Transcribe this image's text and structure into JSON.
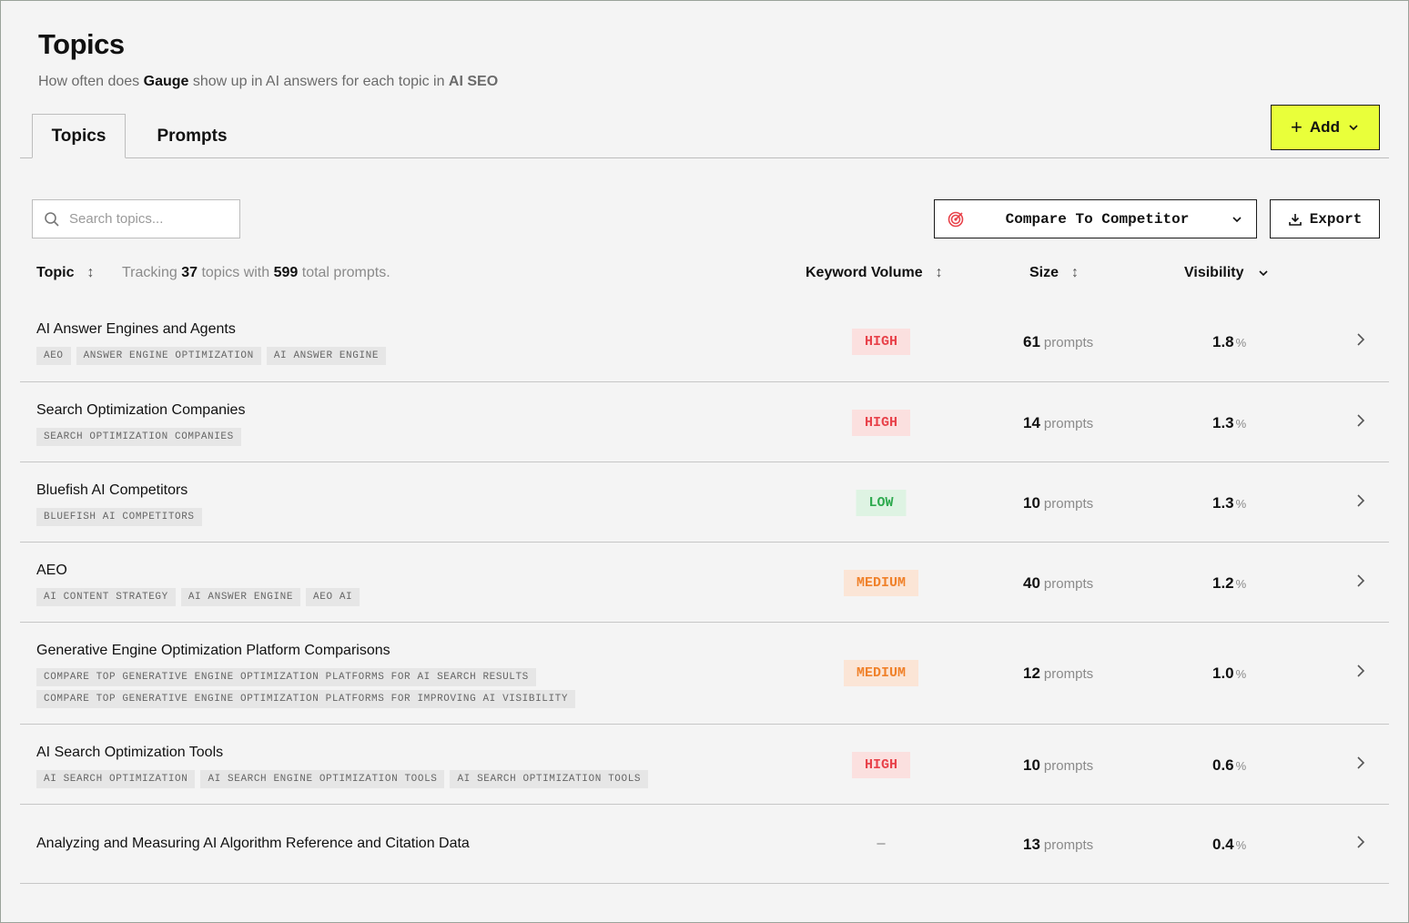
{
  "header": {
    "title": "Topics",
    "subtitle_prefix": "How often does ",
    "brand": "Gauge",
    "subtitle_mid": " show up in AI answers for each topic in ",
    "project": "AI SEO"
  },
  "tabs": [
    {
      "label": "Topics",
      "active": true
    },
    {
      "label": "Prompts",
      "active": false
    }
  ],
  "add_button": {
    "label": "Add"
  },
  "search": {
    "placeholder": "Search topics..."
  },
  "compare_button": {
    "label": "Compare To Competitor"
  },
  "export_button": {
    "label": "Export"
  },
  "table": {
    "col_topic": "Topic",
    "tracking_prefix": "Tracking ",
    "tracking_topics": "37",
    "tracking_mid": " topics with ",
    "tracking_prompts": "599",
    "tracking_suffix": " total prompts.",
    "col_keyword": "Keyword Volume",
    "col_size": "Size",
    "col_visibility": "Visibility",
    "rows": [
      {
        "title": "AI Answer Engines and Agents",
        "tags": [
          [
            "AEO",
            "ANSWER ENGINE OPTIMIZATION",
            "AI ANSWER ENGINE"
          ]
        ],
        "volume": "HIGH",
        "volume_level": "high",
        "size": "61",
        "size_unit": "prompts",
        "visibility": "1.8",
        "vis_unit": "%"
      },
      {
        "title": "Search Optimization Companies",
        "tags": [
          [
            "SEARCH OPTIMIZATION COMPANIES"
          ]
        ],
        "volume": "HIGH",
        "volume_level": "high",
        "size": "14",
        "size_unit": "prompts",
        "visibility": "1.3",
        "vis_unit": "%"
      },
      {
        "title": "Bluefish AI Competitors",
        "tags": [
          [
            "BLUEFISH AI COMPETITORS"
          ]
        ],
        "volume": "LOW",
        "volume_level": "low",
        "size": "10",
        "size_unit": "prompts",
        "visibility": "1.3",
        "vis_unit": "%"
      },
      {
        "title": "AEO",
        "tags": [
          [
            "AI CONTENT STRATEGY",
            "AI ANSWER ENGINE",
            "AEO AI"
          ]
        ],
        "volume": "MEDIUM",
        "volume_level": "medium",
        "size": "40",
        "size_unit": "prompts",
        "visibility": "1.2",
        "vis_unit": "%"
      },
      {
        "title": "Generative Engine Optimization Platform Comparisons",
        "tags": [
          [
            "COMPARE TOP GENERATIVE ENGINE OPTIMIZATION PLATFORMS FOR AI SEARCH RESULTS"
          ],
          [
            "COMPARE TOP GENERATIVE ENGINE OPTIMIZATION PLATFORMS FOR IMPROVING AI VISIBILITY"
          ]
        ],
        "volume": "MEDIUM",
        "volume_level": "medium",
        "size": "12",
        "size_unit": "prompts",
        "visibility": "1.0",
        "vis_unit": "%"
      },
      {
        "title": "AI Search Optimization Tools",
        "tags": [
          [
            "AI SEARCH OPTIMIZATION",
            "AI SEARCH ENGINE OPTIMIZATION TOOLS",
            "AI SEARCH OPTIMIZATION TOOLS"
          ]
        ],
        "volume": "HIGH",
        "volume_level": "high",
        "size": "10",
        "size_unit": "prompts",
        "visibility": "0.6",
        "vis_unit": "%"
      },
      {
        "title": "Analyzing and Measuring AI Algorithm Reference and Citation Data",
        "tags": [],
        "volume": "—",
        "volume_level": "none",
        "size": "13",
        "size_unit": "prompts",
        "visibility": "0.4",
        "vis_unit": "%"
      }
    ]
  },
  "colors": {
    "accent": "#e9ff3a",
    "high": "#e8424a",
    "low": "#2eaa4f",
    "medium": "#f0812a"
  },
  "icons": {
    "search": "search-icon",
    "target": "target-icon",
    "download": "download-icon",
    "chevron": "chevron-right-icon"
  }
}
